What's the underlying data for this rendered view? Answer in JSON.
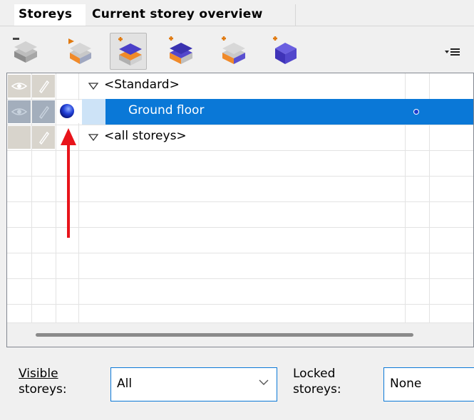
{
  "tabs": [
    {
      "label": "Storeys",
      "active": true
    },
    {
      "label": "Current storey overview",
      "active": false
    }
  ],
  "toolbar": {
    "buttons": [
      {
        "name": "delete-storey-icon",
        "pressed": false
      },
      {
        "name": "assign-storey-icon",
        "pressed": false
      },
      {
        "name": "insert-storey-above-icon",
        "pressed": true
      },
      {
        "name": "insert-storey-below-icon",
        "pressed": false
      },
      {
        "name": "insert-storey-between-icon",
        "pressed": false
      },
      {
        "name": "new-storey-block-icon",
        "pressed": false
      }
    ],
    "menu_icon": "list-menu-icon"
  },
  "tree": {
    "rows": [
      {
        "label": "<Standard>",
        "expanded": true,
        "selected": false
      },
      {
        "label": "Ground floor",
        "expanded": null,
        "selected": true
      },
      {
        "label": "<all storeys>",
        "expanded": true,
        "selected": false
      }
    ]
  },
  "bottom": {
    "visible_label_line1": "Visible",
    "visible_label_line2": "storeys:",
    "visible_value": "All",
    "locked_label_line1": "Locked",
    "locked_label_line2": "storeys:",
    "locked_value": "None"
  },
  "colors": {
    "selection": "#0a78d7",
    "arrow": "#e8141b"
  }
}
